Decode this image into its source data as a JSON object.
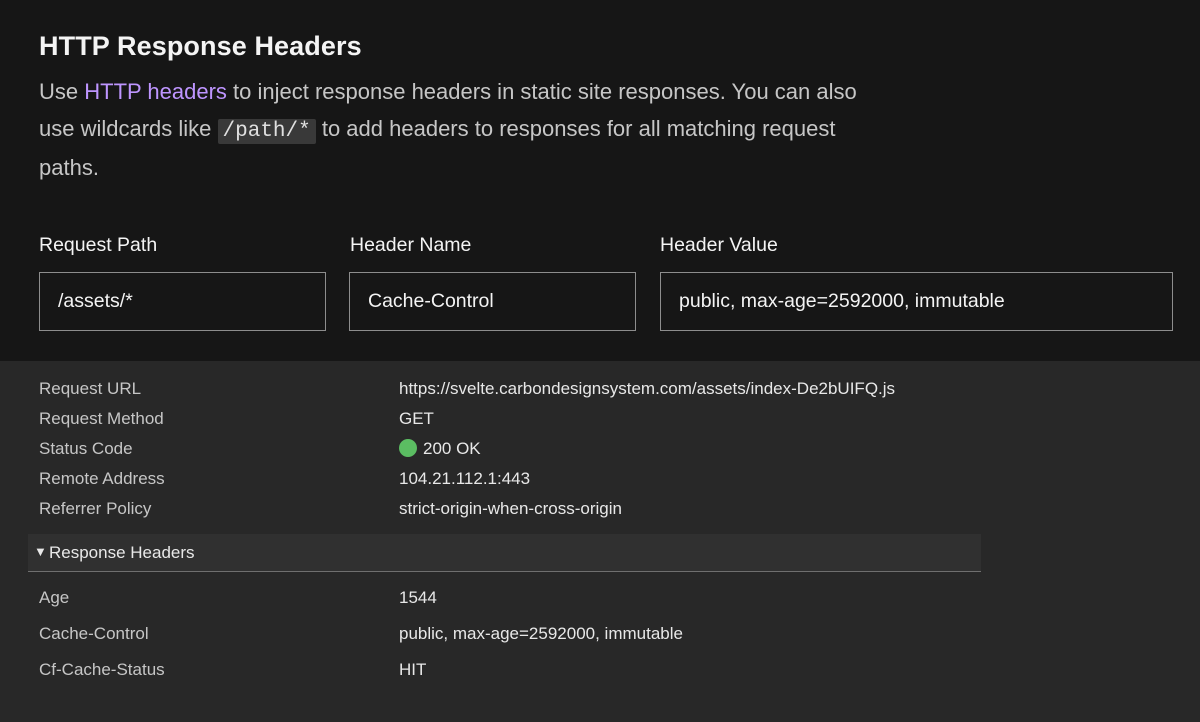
{
  "header": {
    "title": "HTTP Response Headers",
    "desc_before_link": "Use ",
    "desc_link": "HTTP headers",
    "desc_mid": " to inject response headers in static site responses. You can also use wildcards like ",
    "desc_code": "/path/*",
    "desc_after_code": " to add headers to responses for all matching request paths."
  },
  "form": {
    "request_path_label": "Request Path",
    "request_path_value": "/assets/*",
    "header_name_label": "Header Name",
    "header_name_value": "Cache-Control",
    "header_value_label": "Header Value",
    "header_value_value": "public, max-age=2592000, immutable"
  },
  "general": [
    {
      "key": "Request URL",
      "value": "https://svelte.carbondesignsystem.com/assets/index-De2bUIFQ.js"
    },
    {
      "key": "Request Method",
      "value": "GET"
    },
    {
      "key": "Status Code",
      "value": "200 OK"
    },
    {
      "key": "Remote Address",
      "value": "104.21.112.1:443"
    },
    {
      "key": "Referrer Policy",
      "value": "strict-origin-when-cross-origin"
    }
  ],
  "response_section": {
    "arrow": "▼",
    "label": "Response Headers"
  },
  "response_headers": [
    {
      "key": "Age",
      "value": "1544"
    },
    {
      "key": "Cache-Control",
      "value": "public, max-age=2592000, immutable"
    },
    {
      "key": "Cf-Cache-Status",
      "value": "HIT"
    }
  ],
  "colors": {
    "link": "#be95ff",
    "status_ok": "#5bbd62",
    "dark_bg": "#161616",
    "panel_bg": "#282828"
  },
  "icons": {
    "status": "green-status-dot-icon",
    "expand": "triangle-down-icon"
  }
}
